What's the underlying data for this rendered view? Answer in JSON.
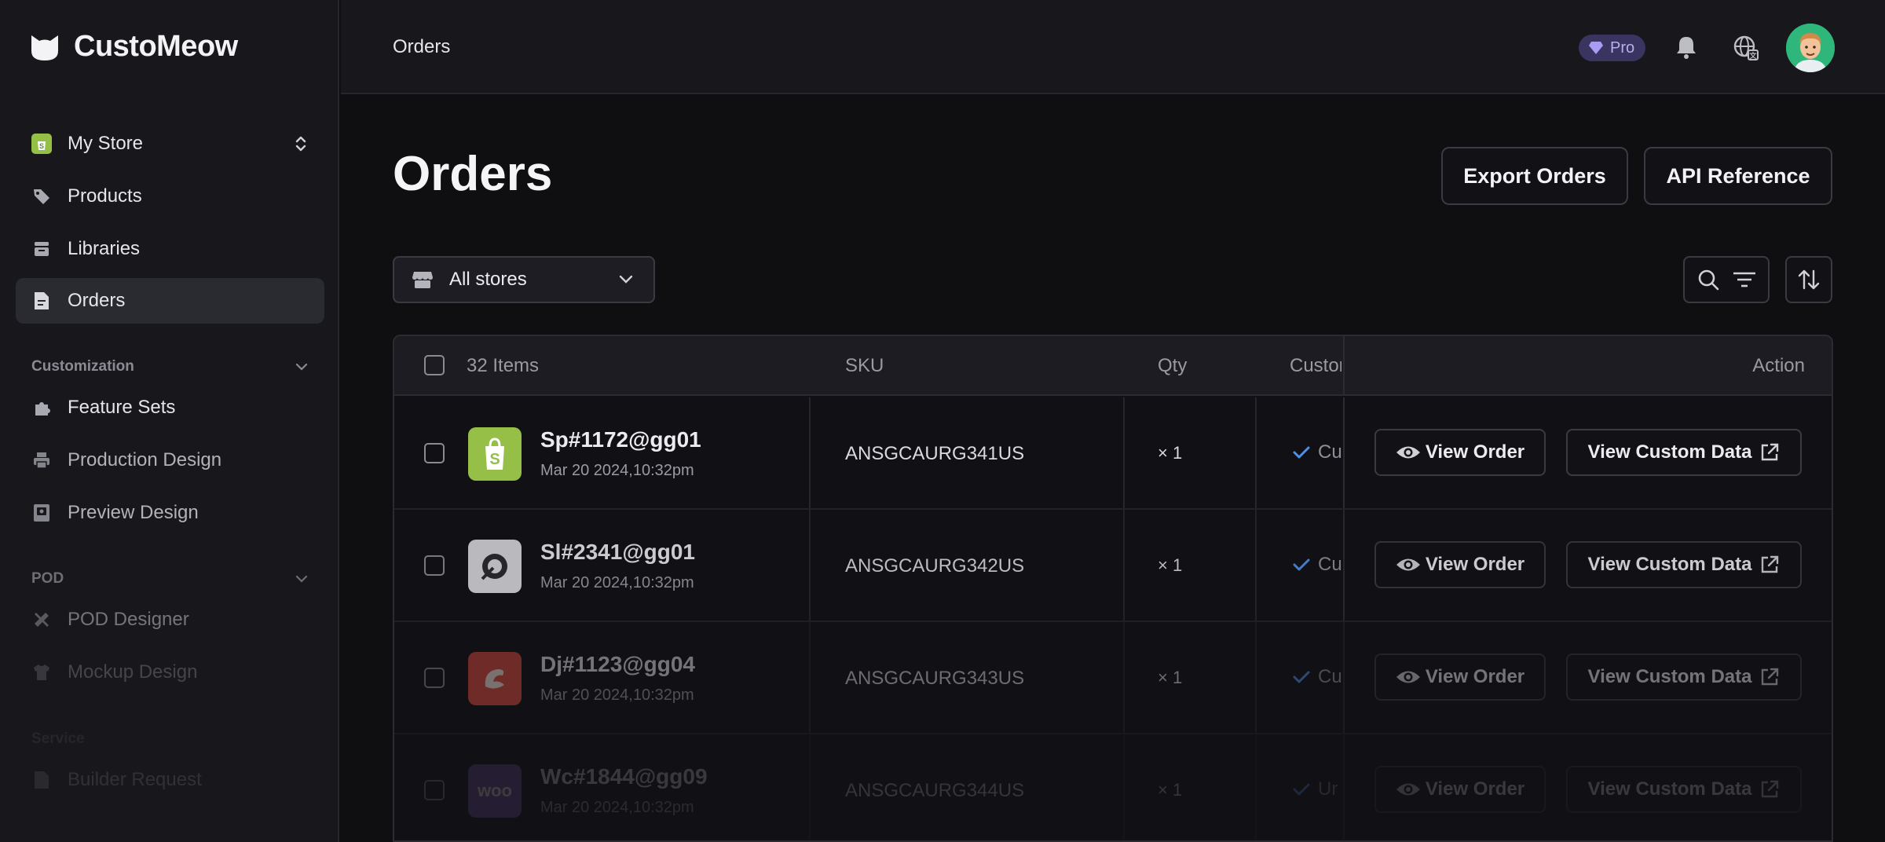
{
  "app": {
    "brand_name": "CustoMeow"
  },
  "sidebar": {
    "store": {
      "label": "My Store"
    },
    "main_items": [
      {
        "label": "Products",
        "icon": "tag-icon"
      },
      {
        "label": "Libraries",
        "icon": "archive-icon"
      },
      {
        "label": "Orders",
        "icon": "file-icon",
        "active": true
      }
    ],
    "sections": [
      {
        "title": "Customization",
        "items": [
          {
            "label": "Feature Sets",
            "icon": "puzzle-icon"
          },
          {
            "label": "Production Design",
            "icon": "printer-icon"
          },
          {
            "label": "Preview Design",
            "icon": "preview-icon"
          }
        ]
      },
      {
        "title": "POD",
        "items": [
          {
            "label": "POD Designer",
            "icon": "tools-icon"
          },
          {
            "label": "Mockup Design",
            "icon": "shirt-icon"
          }
        ]
      },
      {
        "title": "Service",
        "items": [
          {
            "label": "Builder Request",
            "icon": "request-icon"
          }
        ]
      }
    ]
  },
  "header": {
    "breadcrumb": "Orders",
    "badge": "Pro"
  },
  "main": {
    "title": "Orders",
    "export_button": "Export Orders",
    "api_button": "API Reference",
    "store_filter": "All stores"
  },
  "table": {
    "item_count": "32 Items",
    "columns": {
      "sku": "SKU",
      "qty": "Qty",
      "customization": "Custom",
      "action": "Action"
    },
    "view_order_label": "View Order",
    "view_custom_label": "View Custom Data",
    "rows": [
      {
        "order": "Sp#1172@gg01",
        "date": "Mar 20 2024,10:32pm",
        "sku": "ANSGCAURG341US",
        "qty": "× 1",
        "status": "Cu",
        "store": "shopify",
        "color": "#95bf47"
      },
      {
        "order": "Sl#2341@gg01",
        "date": "Mar 20 2024,10:32pm",
        "sku": "ANSGCAURG342US",
        "qty": "× 1",
        "status": "Cu",
        "store": "shopline",
        "color": "#d8d8dc"
      },
      {
        "order": "Dj#1123@gg04",
        "date": "Mar 20 2024,10:32pm",
        "sku": "ANSGCAURG343US",
        "qty": "× 1",
        "status": "Cu",
        "store": "dj",
        "color": "#e04b3f"
      },
      {
        "order": "Wc#1844@gg09",
        "date": "Mar 20 2024,10:32pm",
        "sku": "ANSGCAURG344US",
        "qty": "× 1",
        "status": "Ur",
        "store": "woo",
        "store_label": "woo",
        "color": "#7f54b3"
      }
    ]
  }
}
